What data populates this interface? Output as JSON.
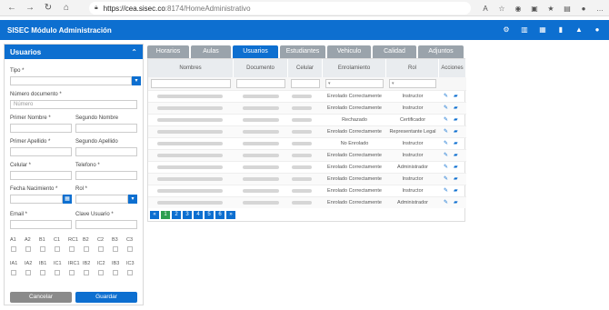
{
  "browser": {
    "url_host": "https://cea.sisec.co",
    "url_rest": ":8174/HomeAdministrativo"
  },
  "app": {
    "title": "SISEC Módulo Administración"
  },
  "form": {
    "title": "Usuarios",
    "tipo_label": "Tipo *",
    "numero_documento_label": "Número documento *",
    "numero_documento_placeholder": "Número",
    "primer_nombre_label": "Primer Nombre *",
    "segundo_nombre_label": "Segundo Nombre",
    "primer_apellido_label": "Primer Apellido *",
    "segundo_apellido_label": "Segundo Apellido",
    "celular_label": "Celular *",
    "telefono_label": "Telefono *",
    "fecha_nacimiento_label": "Fecha Nacimiento *",
    "rol_label": "Rol *",
    "email_label": "Email *",
    "clave_label": "Clave Usuario *",
    "permissions_row1": [
      "A1",
      "A2",
      "B1",
      "C1",
      "RC1",
      "B2",
      "C2",
      "B3",
      "C3"
    ],
    "permissions_row2": [
      "IA1",
      "IA2",
      "IB1",
      "IC1",
      "IRC1",
      "IB2",
      "IC2",
      "IB3",
      "IC3"
    ],
    "cancel_label": "Cancelar",
    "save_label": "Guardar"
  },
  "tabs": [
    {
      "label": "Horarios"
    },
    {
      "label": "Aulas"
    },
    {
      "label": "Usuarios"
    },
    {
      "label": "Estudiantes"
    },
    {
      "label": "Vehiculo"
    },
    {
      "label": "Calidad"
    },
    {
      "label": "Adjuntos"
    }
  ],
  "table": {
    "headers": [
      "Nombres",
      "Documento",
      "Celular",
      "Enrolamiento",
      "Rol",
      "Acciones"
    ],
    "rows": [
      {
        "enrolamiento": "Enrolado Correctamente",
        "rol": "Instructor"
      },
      {
        "enrolamiento": "Enrolado Correctamente",
        "rol": "Instructor"
      },
      {
        "enrolamiento": "Rechazado",
        "rol": "Certificador"
      },
      {
        "enrolamiento": "Enrolado Correctamente",
        "rol": "Representante Legal"
      },
      {
        "enrolamiento": "No Enrolado",
        "rol": "Instructor"
      },
      {
        "enrolamiento": "Enrolado Correctamente",
        "rol": "Instructor"
      },
      {
        "enrolamiento": "Enrolado Correctamente",
        "rol": "Administrador"
      },
      {
        "enrolamiento": "Enrolado Correctamente",
        "rol": "Instructor"
      },
      {
        "enrolamiento": "Enrolado Correctamente",
        "rol": "Instructor"
      },
      {
        "enrolamiento": "Enrolado Correctamente",
        "rol": "Administrador"
      }
    ]
  },
  "pagination": {
    "prev": "«",
    "pages": [
      "1",
      "2",
      "3",
      "4",
      "5",
      "6"
    ],
    "next": "»"
  },
  "icons": {
    "edit": "edit-icon",
    "folder": "folder-icon"
  },
  "colors": {
    "primary": "#0d6fd0",
    "tab_inactive": "#9aa3ab",
    "pager_active": "#2e9e4f"
  }
}
